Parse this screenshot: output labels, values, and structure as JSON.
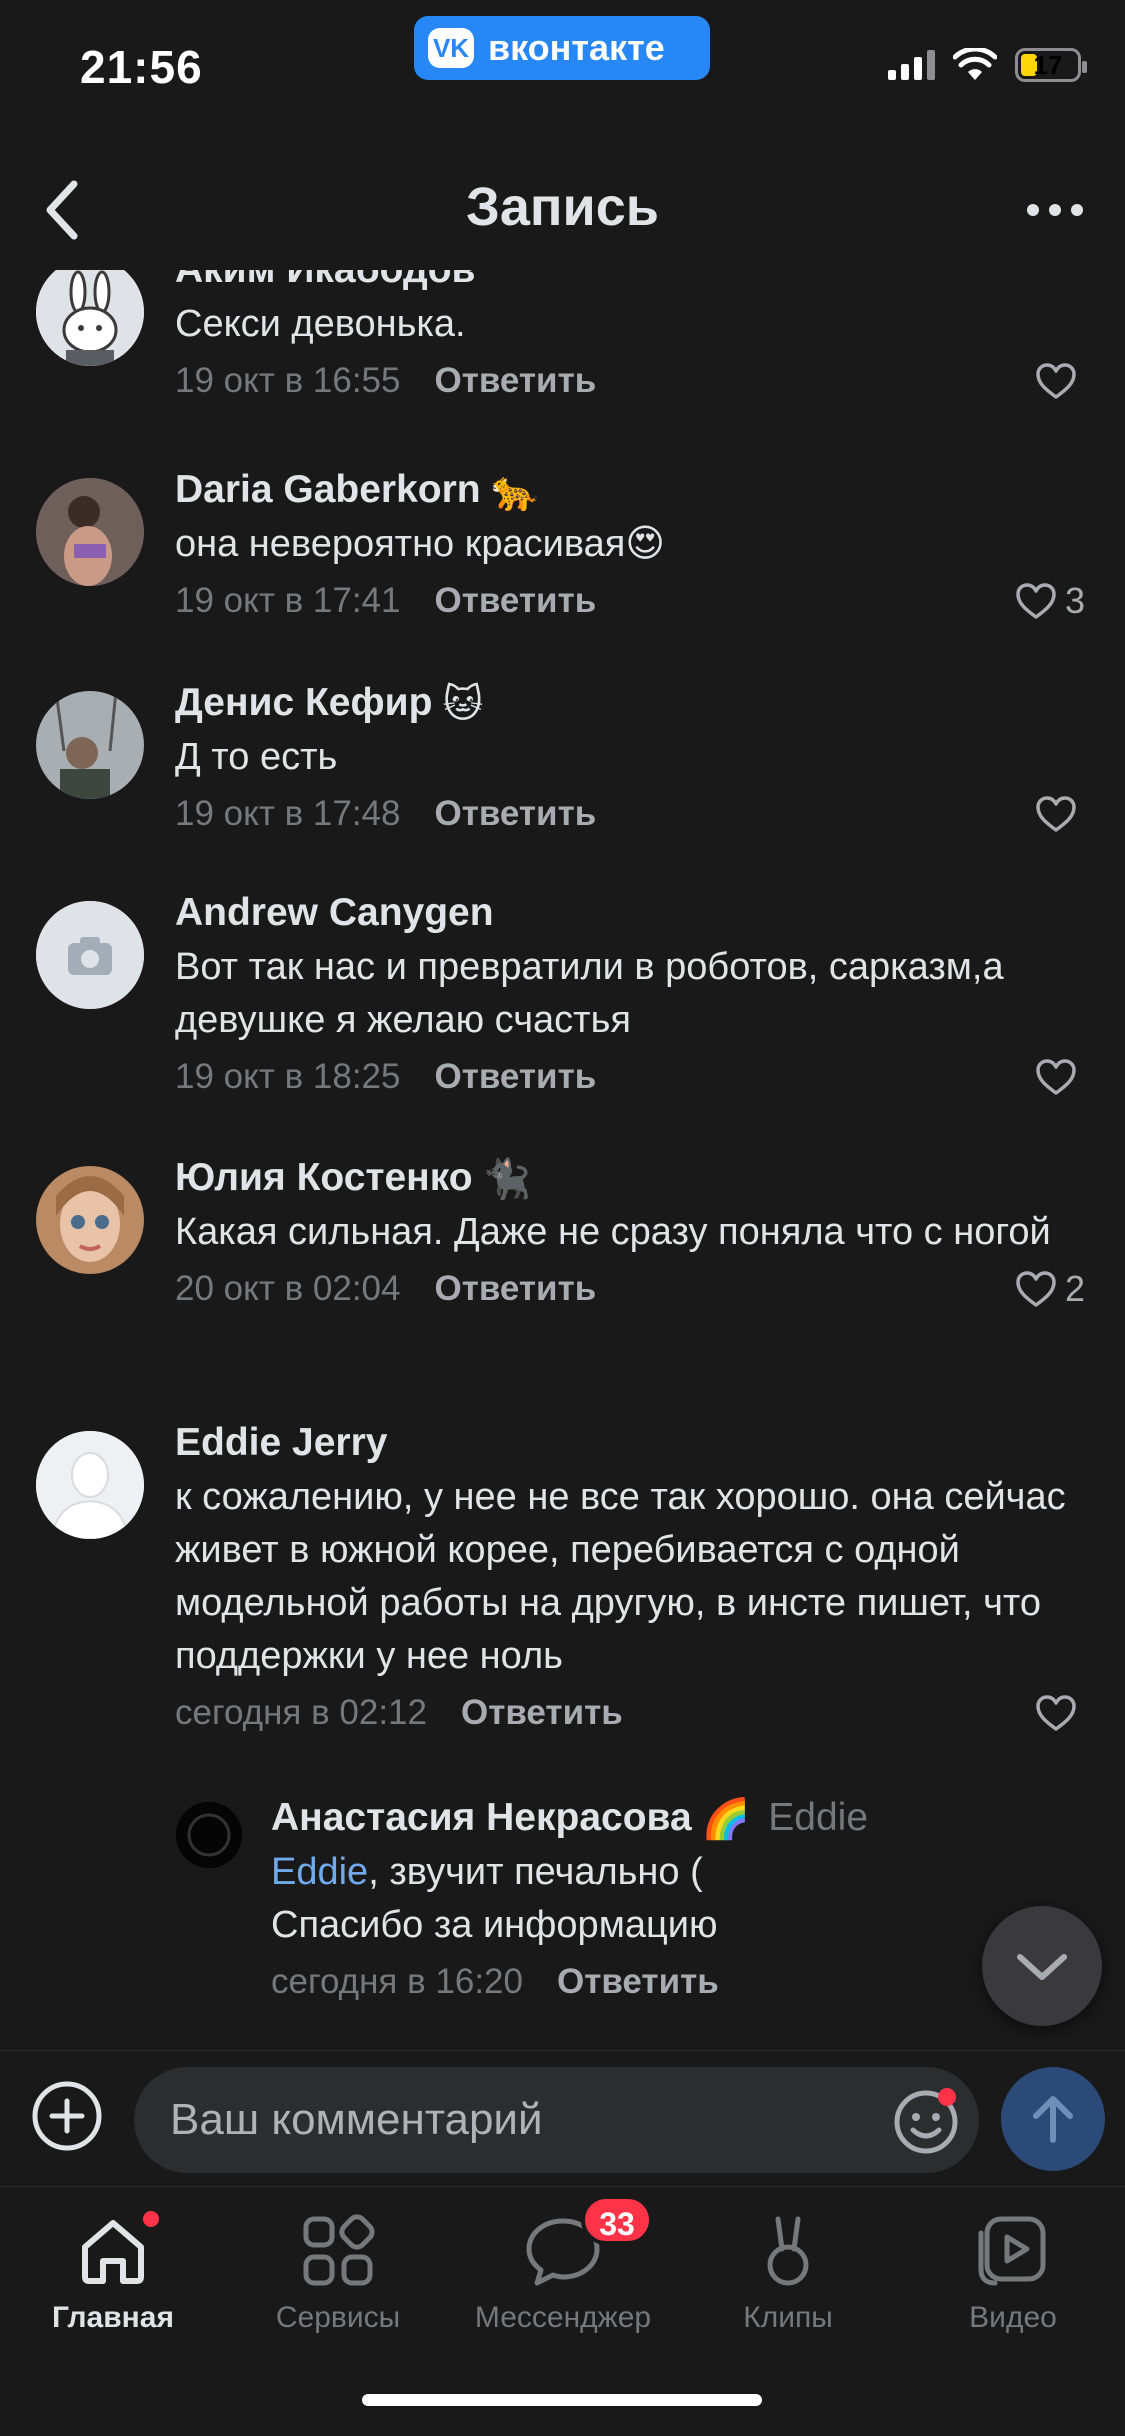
{
  "status_bar": {
    "time": "21:56",
    "app_badge": "вконтакте",
    "app_logo": "VK",
    "battery_level": "17"
  },
  "header": {
    "title": "Запись"
  },
  "comments": [
    {
      "author": "Аким Икабодов",
      "text": "Секси девонька.",
      "date": "19 окт в 16:55",
      "reply_label": "Ответить",
      "likes": ""
    },
    {
      "author": "Daria Gaberkorn",
      "author_emoji": "🐆",
      "text": "она невероятно красивая",
      "text_emoji": "😍",
      "date": "19 окт в 17:41",
      "reply_label": "Ответить",
      "likes": "3"
    },
    {
      "author": "Денис Кефир",
      "author_emoji": "🐱",
      "text": "Д то есть",
      "date": "19 окт в 17:48",
      "reply_label": "Ответить",
      "likes": ""
    },
    {
      "author": "Andrew Canygen",
      "text": "Вот так нас и превратили в роботов, сарказм,а девушке я желаю счастья",
      "date": "19 окт в 18:25",
      "reply_label": "Ответить",
      "likes": ""
    },
    {
      "author": "Юлия Костенко",
      "author_emoji": "🐈‍⬛",
      "text": "Какая сильная. Даже не сразу поняла что с ногой",
      "date": "20 окт в 02:04",
      "reply_label": "Ответить",
      "likes": "2"
    },
    {
      "author": "Eddie Jerry",
      "text": "к сожалению, у нее не все так хорошо. она сейчас живет в южной корее, перебивается с одной модельной работы на другую, в инсте пишет, что поддержки у нее ноль",
      "date": "сегодня в 02:12",
      "reply_label": "Ответить",
      "likes": ""
    }
  ],
  "reply": {
    "author": "Анастасия Некрасова",
    "author_emoji": "🌈",
    "reply_to": "Eddie",
    "mention": "Eddie",
    "text_line1": ", звучит печально (",
    "text_line2": "Спасибо за информацию",
    "date": "сегодня в 16:20",
    "reply_label": "Ответить"
  },
  "composer": {
    "placeholder": "Ваш комментарий"
  },
  "tabs": [
    {
      "label": "Главная",
      "icon": "home-icon",
      "active": true
    },
    {
      "label": "Сервисы",
      "icon": "services-icon",
      "active": false
    },
    {
      "label": "Мессенджер",
      "icon": "messenger-icon",
      "active": false,
      "badge": "33"
    },
    {
      "label": "Клипы",
      "icon": "clips-icon",
      "active": false
    },
    {
      "label": "Видео",
      "icon": "video-icon",
      "active": false
    }
  ],
  "colors": {
    "background": "#19191a",
    "accent": "#2787f5",
    "mention": "#71aaeb",
    "badge": "#ff3347"
  }
}
